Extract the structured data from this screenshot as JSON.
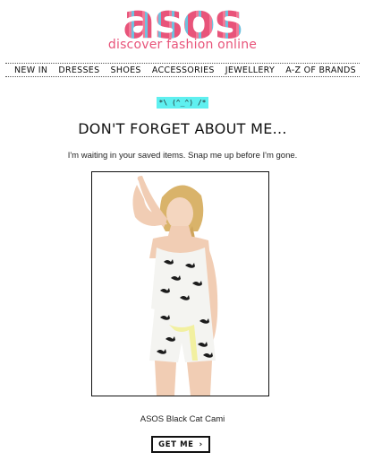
{
  "brand": {
    "logo_text": "asos",
    "tagline": "discover fashion online"
  },
  "nav": {
    "items": [
      "NEW IN",
      "DRESSES",
      "SHOES",
      "ACCESSORIES",
      "JEWELLERY",
      "A-Z OF BRANDS"
    ]
  },
  "email": {
    "emoticon": "*\\ (^_^) /*",
    "headline": "DON'T FORGET ABOUT ME...",
    "subtext": "I'm waiting in your saved items. Snap me up before I'm gone."
  },
  "product": {
    "name": "ASOS Black Cat Cami",
    "cta_label": "GET ME",
    "cta_icon": "chevron-right-icon"
  },
  "colors": {
    "brand_pink": "#e8547a",
    "brand_blue": "#6fc0dd",
    "emoticon_bg": "#5ff0f0"
  }
}
